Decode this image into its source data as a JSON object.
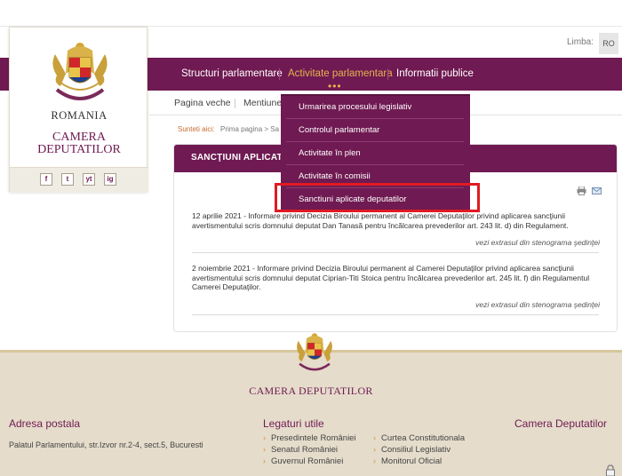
{
  "colors": {
    "brand_purple": "#6f1a52",
    "accent_gold": "#e6b34d",
    "highlight_red": "#e01a22",
    "footer_bg": "#e5dccb"
  },
  "lang": {
    "label": "Limba:",
    "current": "RO"
  },
  "logo": {
    "country": "ROMANIA",
    "line1": "CAMERA",
    "line2": "DEPUTATILOR",
    "social": [
      "f",
      "t",
      "yt",
      "ig"
    ],
    "social_icons": [
      "facebook-icon",
      "twitter-icon",
      "youtube-icon",
      "instagram-icon"
    ]
  },
  "nav": {
    "items": [
      "Structuri parlamentare",
      "Activitate parlamentara",
      "Informatii publice"
    ],
    "dots": "•••"
  },
  "subnav": {
    "items": [
      "Pagina veche",
      "Mentiune"
    ]
  },
  "breadcrumb": {
    "label": "Sunteti aici:",
    "path": "Prima pagina > Sa"
  },
  "dropdown": {
    "items": [
      "Urmarirea procesului legislativ",
      "Controlul parlamentar",
      "Activitate în plen",
      "Activitate în comisii",
      "Sanctiuni aplicate deputatilor"
    ],
    "highlighted_index": 4
  },
  "content": {
    "title": "SANCŢIUNI APLICATE",
    "entries": [
      {
        "text": "12 aprilie 2021 - Informare privind Decizia Biroului permanent al Camerei Deputaţilor privind aplicarea sancţiunii avertismentului scris domnului deputat Dan Tanasă pentru încălcarea prevederilor art. 243 lit. d) din Regulament.",
        "link": "vezi extrasul din stenograma şedinţei"
      },
      {
        "text": "2 noiembrie 2021 - Informare privind Decizia Biroului permanent al Camerei Deputaţilor privind aplicarea sancţiunii avertismentului scris domnului deputat Ciprian-Titi Stoica pentru încălcarea prevederilor art. 245 lit. f) din Regulamentul Camerei Deputaţilor.",
        "link": "vezi extrasul din stenograma şedinţei"
      }
    ]
  },
  "footer": {
    "title": "CAMERA DEPUTATILOR",
    "address_heading": "Adresa postala",
    "address": "Palatul Parlamentului, str.Izvor nr.2-4, sect.5, Bucuresti",
    "links_heading": "Legaturi utile",
    "links_col1": [
      "Presedintele României",
      "Senatul României",
      "Guvernul României"
    ],
    "links_col2": [
      "Curtea Constitutionala",
      "Consiliul Legislativ",
      "Monitorul Oficial"
    ],
    "right_heading": "Camera Deputatilor"
  }
}
